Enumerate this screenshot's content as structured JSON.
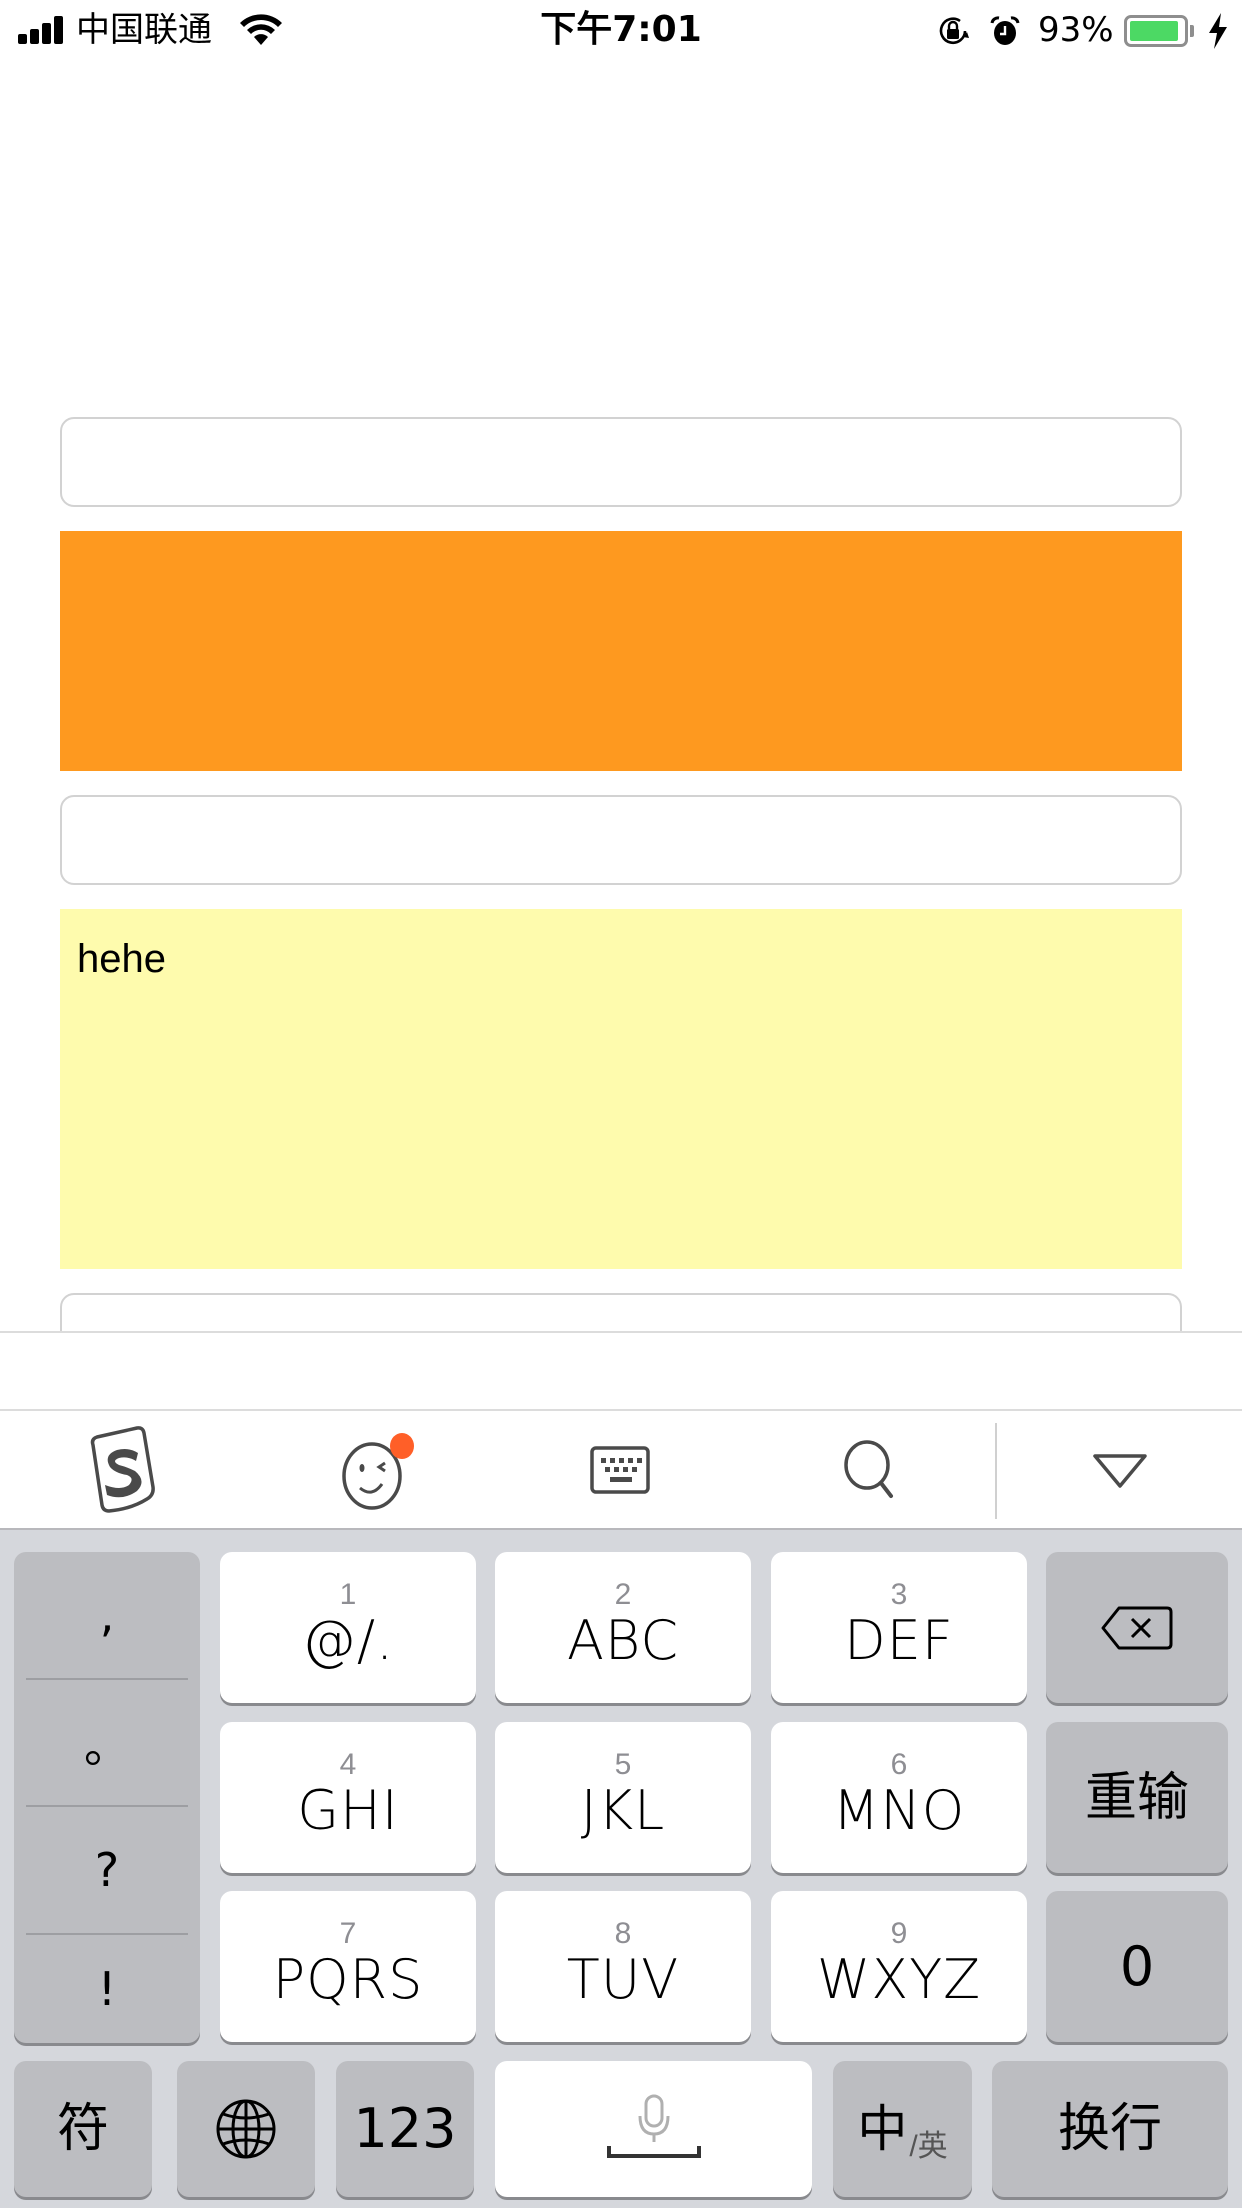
{
  "status_bar": {
    "carrier": "中国联通",
    "time": "下午7:01",
    "battery_percent_label": "93%",
    "battery_level": 0.93,
    "icons": [
      "signal-icon",
      "wifi-icon",
      "orientation-lock-icon",
      "alarm-icon",
      "battery-icon",
      "charging-bolt-icon"
    ]
  },
  "page": {
    "fields": [
      {
        "name": "text-input-1",
        "value": "",
        "placeholder": ""
      },
      {
        "name": "text-input-2",
        "value": "",
        "placeholder": ""
      },
      {
        "name": "text-input-3",
        "value": "",
        "placeholder": ""
      }
    ],
    "orange_block": {
      "color": "#fe991f"
    },
    "textarea": {
      "value": "hehe",
      "background": "#fefbad"
    }
  },
  "keyboard_toolbar": {
    "items": [
      {
        "name": "sogou-logo",
        "icon": "sogou-s-icon"
      },
      {
        "name": "emoji",
        "icon": "wink-face-icon",
        "badge_color": "#ff5f28"
      },
      {
        "name": "keyboard-switch",
        "icon": "keyboard-icon"
      },
      {
        "name": "search",
        "icon": "search-icon"
      },
      {
        "name": "hide-keyboard",
        "icon": "triangle-down-icon"
      }
    ]
  },
  "keyboard": {
    "punctuation": [
      ",",
      "。",
      "?",
      "!"
    ],
    "keys": [
      {
        "num": "1",
        "letters": "@/."
      },
      {
        "num": "2",
        "letters": "ABC"
      },
      {
        "num": "3",
        "letters": "DEF"
      },
      {
        "num": "4",
        "letters": "GHI"
      },
      {
        "num": "5",
        "letters": "JKL"
      },
      {
        "num": "6",
        "letters": "MNO"
      },
      {
        "num": "7",
        "letters": "PQRS"
      },
      {
        "num": "8",
        "letters": "TUV"
      },
      {
        "num": "9",
        "letters": "WXYZ"
      }
    ],
    "delete_icon": "backspace-icon",
    "reenter": "重输",
    "zero": "0",
    "symbols": "符",
    "globe_icon": "globe-icon",
    "numbers": "123",
    "space_icon": "microphone-icon",
    "lang_primary": "中",
    "lang_secondary": "/英",
    "return": "换行"
  }
}
